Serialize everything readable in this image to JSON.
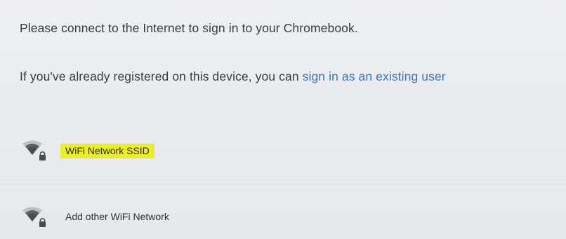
{
  "messages": {
    "connect_prompt": "Please connect to the Internet to sign in to your Chromebook.",
    "registered_prefix": "If you've already registered on this device, you can ",
    "existing_user_link": "sign in as an existing user"
  },
  "networks": [
    {
      "name": "WiFi Network SSID",
      "icon": "wifi-locked-icon",
      "highlighted": true
    },
    {
      "name": "Add other WiFi Network",
      "icon": "wifi-locked-icon",
      "highlighted": false
    }
  ],
  "colors": {
    "link": "#3f73b8",
    "highlight": "#ecee2b",
    "icon": "#4a4b4e"
  }
}
